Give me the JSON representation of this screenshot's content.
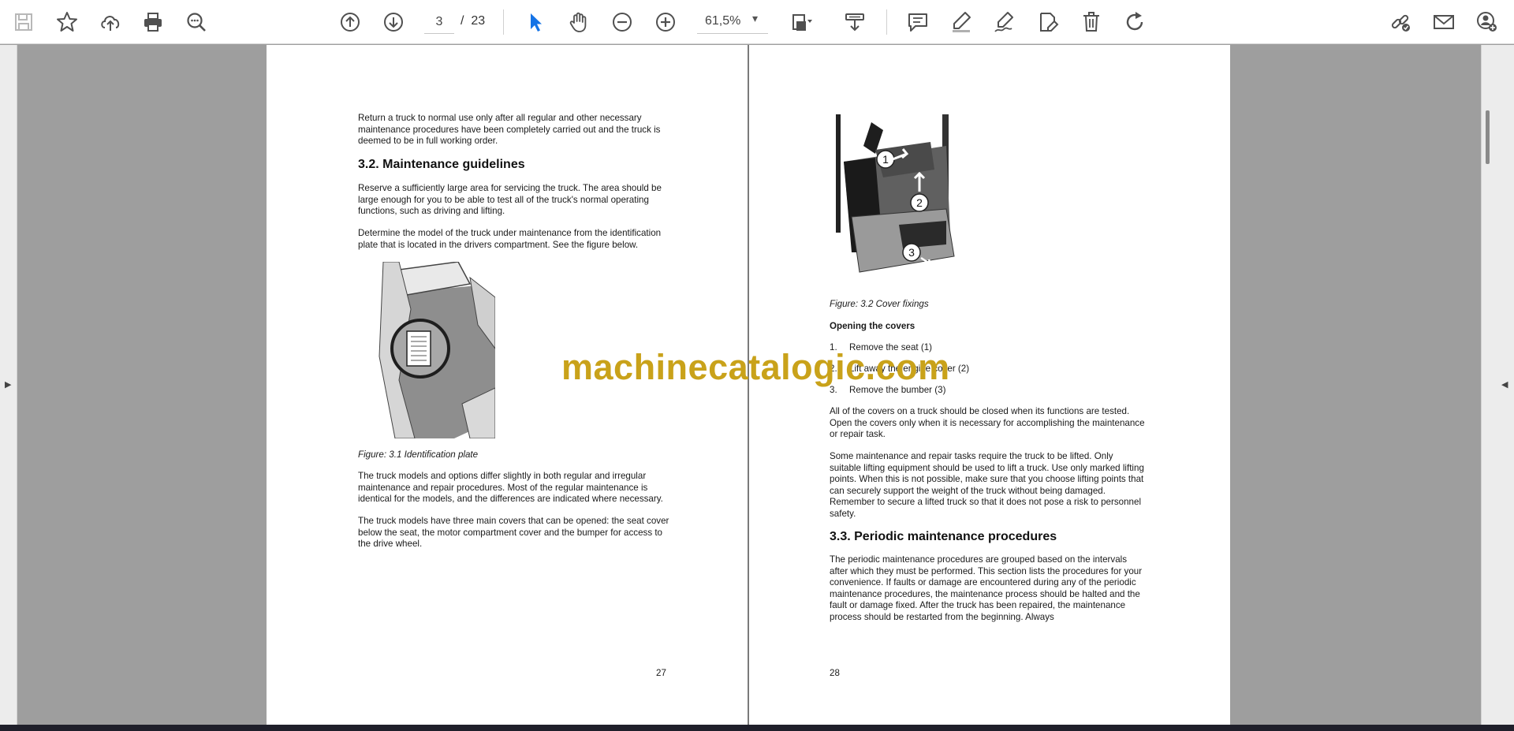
{
  "toolbar": {
    "page_current": "3",
    "page_separator": "/",
    "page_total": "23",
    "zoom_value": "61,5%",
    "zoom_caret": "▾"
  },
  "rails": {
    "left_arrow": "▶",
    "right_arrow": "◀"
  },
  "watermark": "machinecatalogic.com",
  "left_page": {
    "para1": "Return a truck to normal use only after all regular and other necessary maintenance procedures have been completely carried out and the truck is deemed to be in full working order.",
    "heading": "3.2. Maintenance guidelines",
    "para2": "Reserve a sufficiently large area for servicing the truck. The area should be large enough for you to be able to test all of the truck's normal operating functions, such as driving and lifting.",
    "para3": "Determine the model of the truck under maintenance from the identification plate that is located in the drivers compartment. See the figure below.",
    "caption": "Figure: 3.1 Identification plate",
    "para4": "The truck models and options differ slightly in both regular and irregular maintenance and repair procedures. Most of the regular maintenance is identical for the models, and the differences are indicated where necessary.",
    "para5": "The truck models have three main covers that can be opened: the seat cover below the seat, the motor compartment cover and the bumper for access to the drive wheel.",
    "page_number": "27"
  },
  "right_page": {
    "caption": "Figure: 3.2 Cover fixings",
    "subheading": "Opening the covers",
    "list": [
      {
        "num": "1.",
        "text": "Remove the seat (1)"
      },
      {
        "num": "2.",
        "text": "Lift away the engine cover (2)"
      },
      {
        "num": "3.",
        "text": "Remove the bumber (3)"
      }
    ],
    "figure_labels": [
      "1",
      "2",
      "3"
    ],
    "para1": "All of the covers on a truck should be closed when its functions are tested. Open the covers only when it is necessary for accomplishing the maintenance or repair task.",
    "para2": "Some maintenance and repair tasks require the truck to be lifted. Only suitable lifting equipment should be used to lift a truck. Use only marked lifting points. When this is not possible, make sure that you choose lifting points that can securely support the weight of the truck without being damaged. Remember to secure a lifted truck so that it does not pose a risk to personnel safety.",
    "heading": "3.3. Periodic maintenance procedures",
    "para3": "The periodic maintenance procedures are grouped based on the intervals after which they must be performed. This section lists the procedures for your convenience. If faults or damage are encountered during any of the periodic maintenance procedures, the maintenance process should be halted and the fault or damage fixed. After the truck has been repaired, the maintenance process should be restarted from the beginning. Always",
    "page_number": "28"
  },
  "colors": {
    "accent": "#1473e6",
    "watermark": "#c9a21a",
    "viewer_bg": "#9e9e9e"
  },
  "icons": [
    "save-icon",
    "bookmark-star-icon",
    "cloud-upload-icon",
    "print-icon",
    "zoom-search-icon",
    "page-up-icon",
    "page-down-icon",
    "select-cursor-icon",
    "hand-pan-icon",
    "zoom-out-icon",
    "zoom-in-icon",
    "page-fit-icon",
    "scroll-mode-icon",
    "comment-icon",
    "highlight-pen-icon",
    "signature-icon",
    "edit-text-icon",
    "delete-icon",
    "rotate-icon",
    "link-share-icon",
    "mail-icon",
    "add-user-icon"
  ]
}
